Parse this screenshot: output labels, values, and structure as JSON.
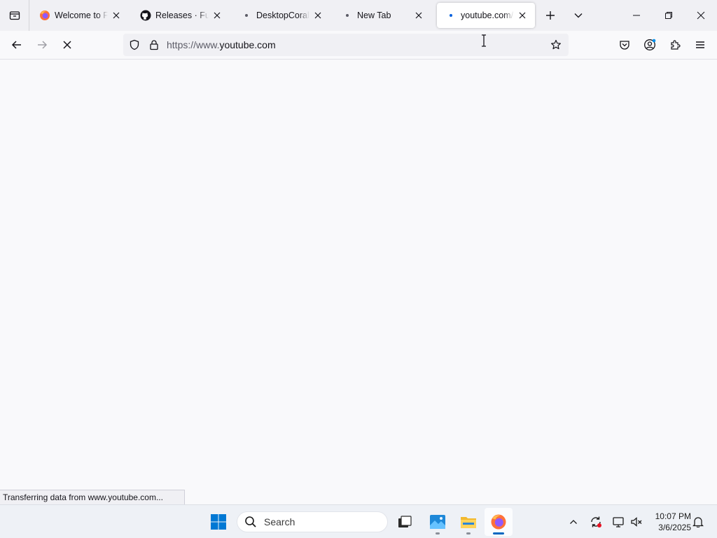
{
  "tabs": [
    {
      "title": "Welcome to Firefox",
      "icon": "firefox-icon",
      "active": false
    },
    {
      "title": "Releases · FutureSpeed",
      "icon": "github-icon",
      "active": false
    },
    {
      "title": "DesktopCoral - Download",
      "icon": "loading-dot-icon",
      "active": false
    },
    {
      "title": "New Tab",
      "icon": "loading-dot-icon",
      "active": false
    },
    {
      "title": "youtube.com/",
      "icon": "loading-dot-icon",
      "active": true
    }
  ],
  "urlbar": {
    "prefix": "https://www.",
    "domain": "youtube.com",
    "full": "https://www.youtube.com"
  },
  "status": {
    "text": "Transferring data from www.youtube.com..."
  },
  "taskbar": {
    "search_label": "Search",
    "time": "10:07 PM",
    "date": "3/6/2025"
  },
  "colors": {
    "accent": "#0060df",
    "taskbar_accent": "#0067c0",
    "firefox_orange": "#ff7139",
    "firefox_purple": "#9059ff"
  }
}
